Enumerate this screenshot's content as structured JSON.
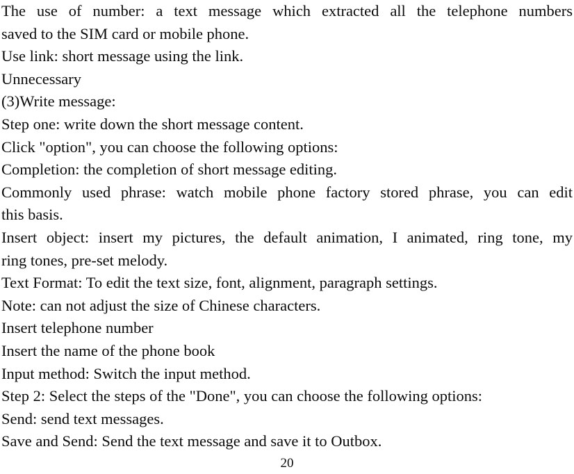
{
  "document": {
    "page_number": "20",
    "lines": [
      {
        "id": "line-1",
        "text": "The use of number: a text message which extracted all the telephone numbers",
        "justified": true
      },
      {
        "id": "line-2",
        "text": "saved to the SIM card or mobile phone.",
        "justified": false
      },
      {
        "id": "line-3",
        "text": "Use link: short message using the link.",
        "justified": false
      },
      {
        "id": "line-4",
        "text": "Unnecessary",
        "justified": false
      },
      {
        "id": "line-5",
        "text": "(3)Write message:",
        "justified": false
      },
      {
        "id": "line-6",
        "text": "Step one: write down the short message content.",
        "justified": false
      },
      {
        "id": "line-7",
        "text": "Click \"option\", you can choose the following options:",
        "justified": false
      },
      {
        "id": "line-8",
        "text": "Completion: the completion of short message editing.",
        "justified": false
      },
      {
        "id": "line-9",
        "text": "Commonly used phrase: watch mobile phone factory stored phrase, you can edit",
        "justified": true
      },
      {
        "id": "line-10",
        "text": "this basis.",
        "justified": false
      },
      {
        "id": "line-11",
        "text": "Insert object: insert my pictures, the default animation, I animated, ring tone, my",
        "justified": true
      },
      {
        "id": "line-12",
        "text": "ring tones, pre-set melody.",
        "justified": false
      },
      {
        "id": "line-13",
        "text": "Text Format: To edit the text size, font, alignment, paragraph settings.",
        "justified": false
      },
      {
        "id": "line-14",
        "text": "Note: can not adjust the size of Chinese characters.",
        "justified": false
      },
      {
        "id": "line-15",
        "text": "Insert telephone number",
        "justified": false
      },
      {
        "id": "line-16",
        "text": "Insert the name of the phone book",
        "justified": false
      },
      {
        "id": "line-17",
        "text": "Input method: Switch the input method.",
        "justified": false
      },
      {
        "id": "line-18",
        "text": "Step 2: Select the steps of the \"Done\", you can choose the following options:",
        "justified": false
      },
      {
        "id": "line-19",
        "text": "Send: send text messages.",
        "justified": false
      },
      {
        "id": "line-20",
        "text": "Save and Send: Send the text message and save it to Outbox.",
        "justified": false
      }
    ]
  }
}
